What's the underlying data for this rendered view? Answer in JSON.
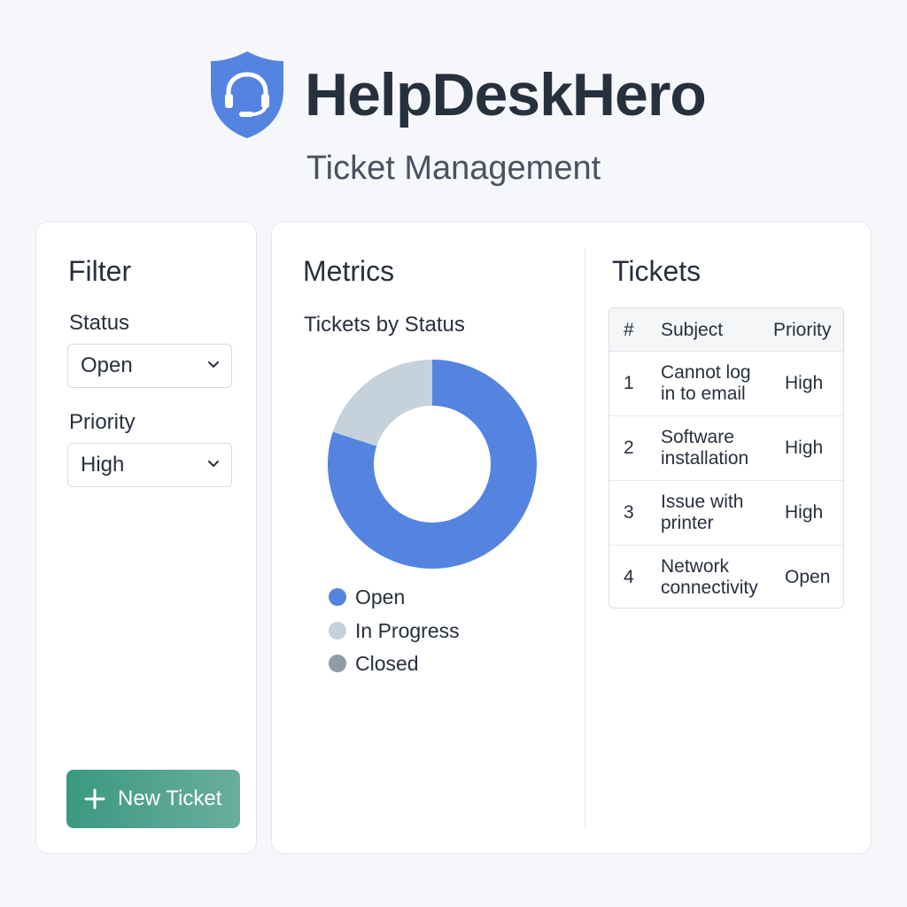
{
  "brand": {
    "name": "HelpDeskHero",
    "subtitle": "Ticket Management"
  },
  "filter": {
    "title": "Filter",
    "status_label": "Status",
    "status_value": "Open",
    "priority_label": "Priority",
    "priority_value": "High",
    "new_ticket_label": "New Ticket"
  },
  "metrics": {
    "title": "Metrics",
    "chart_title": "Tickets by Status",
    "legend": [
      {
        "label": "Open",
        "color": "#5584e0"
      },
      {
        "label": "In Progress",
        "color": "#c5d1db"
      },
      {
        "label": "Closed",
        "color": "#909baa"
      }
    ]
  },
  "chart_data": {
    "type": "pie",
    "title": "Tickets by Status",
    "categories": [
      "Open",
      "In Progress",
      "Closed"
    ],
    "values": [
      80,
      20,
      0
    ],
    "unit": "percent",
    "colors": [
      "#5584e0",
      "#c5d1db",
      "#909baa"
    ],
    "donut": true,
    "legend": "bottom"
  },
  "tickets": {
    "title": "Tickets",
    "columns": [
      "#",
      "Subject",
      "Priority"
    ],
    "rows": [
      {
        "id": "1",
        "subject_line1": "Cannot log",
        "subject_line2": "in to email",
        "priority": "High"
      },
      {
        "id": "2",
        "subject_line1": "Software",
        "subject_line2": "installation",
        "priority": "High"
      },
      {
        "id": "3",
        "subject_line1": "Issue with",
        "subject_line2": "printer",
        "priority": "High"
      },
      {
        "id": "4",
        "subject_line1": "Network",
        "subject_line2": "connectivity",
        "priority": "Open"
      }
    ]
  },
  "colors": {
    "brand_blue": "#5584e0",
    "text_dark": "#27303d",
    "button_green": "#3a9981",
    "page_bg": "#f5f7fa"
  },
  "icons": [
    "shield-headset-icon",
    "chevron-down-icon",
    "plus-icon"
  ]
}
